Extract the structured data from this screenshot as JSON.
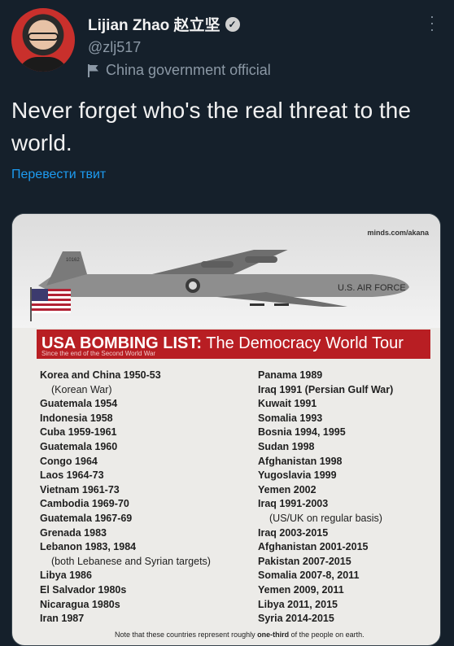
{
  "tweet": {
    "author_name": "Lijian Zhao 赵立坚",
    "handle": "@zlj517",
    "account_label": "China government official",
    "text": "Never forget who's the real threat to the world.",
    "translate_link": "Перевести твит"
  },
  "image": {
    "source_tag": "minds.com/akana",
    "aircraft_marking": "U.S. AIR FORCE",
    "tail_number": "10162",
    "title_bold": "USA BOMBING LIST:",
    "title_rest": "The Democracy World Tour",
    "subtitle": "Since the end of the Second World War",
    "left_list": [
      {
        "text": "Korea and China 1950-53",
        "note": false
      },
      {
        "text": "(Korean War)",
        "note": true
      },
      {
        "text": "Guatemala 1954",
        "note": false
      },
      {
        "text": "Indonesia 1958",
        "note": false
      },
      {
        "text": "Cuba 1959-1961",
        "note": false
      },
      {
        "text": "Guatemala 1960",
        "note": false
      },
      {
        "text": "Congo 1964",
        "note": false
      },
      {
        "text": "Laos 1964-73",
        "note": false
      },
      {
        "text": "Vietnam 1961-73",
        "note": false
      },
      {
        "text": "Cambodia 1969-70",
        "note": false
      },
      {
        "text": "Guatemala 1967-69",
        "note": false
      },
      {
        "text": "Grenada 1983",
        "note": false
      },
      {
        "text": "Lebanon 1983, 1984",
        "note": false
      },
      {
        "text": "(both Lebanese and Syrian targets)",
        "note": true
      },
      {
        "text": "Libya 1986",
        "note": false
      },
      {
        "text": "El Salvador 1980s",
        "note": false
      },
      {
        "text": "Nicaragua 1980s",
        "note": false
      },
      {
        "text": "Iran 1987",
        "note": false
      }
    ],
    "right_list": [
      {
        "text": "Panama 1989",
        "note": false
      },
      {
        "text": "Iraq 1991 (Persian Gulf War)",
        "note": false
      },
      {
        "text": "Kuwait 1991",
        "note": false
      },
      {
        "text": "Somalia 1993",
        "note": false
      },
      {
        "text": "Bosnia 1994, 1995",
        "note": false
      },
      {
        "text": "Sudan 1998",
        "note": false
      },
      {
        "text": "Afghanistan 1998",
        "note": false
      },
      {
        "text": "Yugoslavia 1999",
        "note": false
      },
      {
        "text": "Yemen 2002",
        "note": false
      },
      {
        "text": "Iraq 1991-2003",
        "note": false
      },
      {
        "text": "(US/UK on regular basis)",
        "note": true
      },
      {
        "text": "Iraq 2003-2015",
        "note": false
      },
      {
        "text": "Afghanistan 2001-2015",
        "note": false
      },
      {
        "text": "Pakistan 2007-2015",
        "note": false
      },
      {
        "text": "Somalia 2007-8, 2011",
        "note": false
      },
      {
        "text": "Yemen 2009, 2011",
        "note": false
      },
      {
        "text": "Libya 2011, 2015",
        "note": false
      },
      {
        "text": "Syria 2014-2015",
        "note": false
      }
    ],
    "footnote_pre": "Note that these countries represent roughly ",
    "footnote_bold": "one-third",
    "footnote_post": " of the people on earth."
  },
  "icons": {
    "verified": "verified-badge-icon",
    "label": "flag-icon",
    "more": "more-options-icon"
  },
  "colors": {
    "background": "#15202b",
    "link": "#1d9bf0",
    "secondary_text": "#8b98a5",
    "banner_red": "#b81e23"
  }
}
